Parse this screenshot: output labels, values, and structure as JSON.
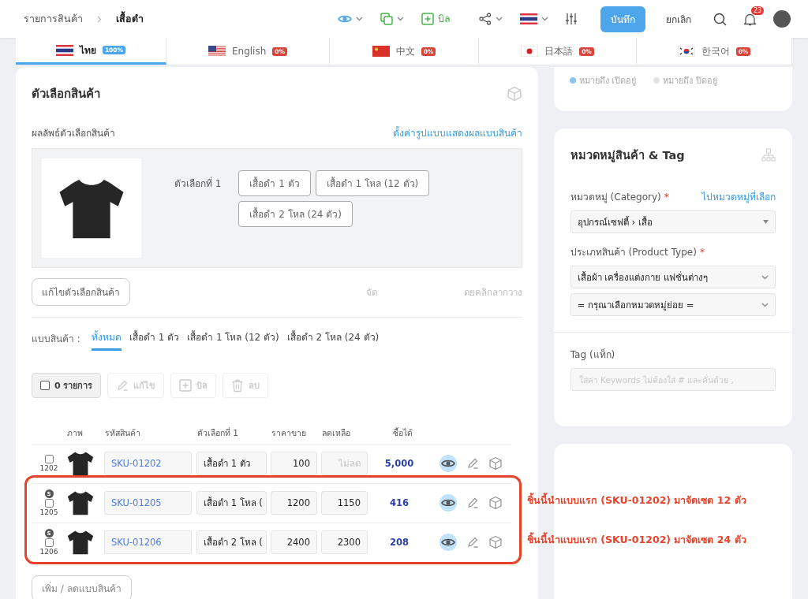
{
  "breadcrumb": {
    "parent": "รายการสินค้า",
    "current": "เสื้อดำ"
  },
  "toolbar": {
    "bill_button": "บิล",
    "save_button": "บันทึก",
    "cancel_button": "ยกเลิก",
    "notification_count": "23"
  },
  "language_tabs": [
    {
      "kind": "th",
      "label": "ไทย",
      "progress": "100%",
      "color": "#4ea6ea",
      "selected": true
    },
    {
      "kind": "us",
      "label": "English",
      "progress": "0%",
      "color": "#d8453b",
      "selected": false
    },
    {
      "kind": "cn",
      "label": "中文",
      "progress": "0%",
      "color": "#d8453b",
      "selected": false
    },
    {
      "kind": "jp",
      "label": "日本語",
      "progress": "0%",
      "color": "#d8453b",
      "selected": false
    },
    {
      "kind": "kr",
      "label": "한국어",
      "progress": "0%",
      "color": "#d8453b",
      "selected": false
    }
  ],
  "variant_card": {
    "title": "ตัวเลือกสินค้า",
    "results_label": "ผลลัพธ์ตัวเลือกสินค้า",
    "display_settings_link": "ตั้งค่ารูปแบบแสดงผลแบบสินค้า",
    "option_label": "ตัวเลือกที่ 1",
    "option_values": [
      "เสื้อดำ 1 ตัว",
      "เสื้อดำ 1 โหล (12 ตัว)",
      "เสื้อดำ 2 โหล (24 ตัว)"
    ],
    "edit_options_button": "แก้ไขตัวเลือกสินค้า",
    "sort_hint_start": "จัด",
    "sort_hint_end": "ดยคลิกลากวาง",
    "filter_label": "แบบสินค้า :",
    "filters": [
      {
        "label": "ทั้งหมด",
        "selected": true
      },
      {
        "label": "เสื้อดำ 1 ตัว",
        "selected": false
      },
      {
        "label": "เสื้อดำ 1 โหล (12 ตัว)",
        "selected": false
      },
      {
        "label": "เสื้อดำ 2 โหล (24 ตัว)",
        "selected": false
      }
    ],
    "bulk_actions": [
      {
        "kind": "select",
        "label": "0 รายการ",
        "checked": false,
        "disabled": false
      },
      {
        "kind": "edit",
        "label": "แก้ไข",
        "disabled": true
      },
      {
        "kind": "bill",
        "label": "บิล",
        "disabled": true
      },
      {
        "kind": "delete",
        "label": "ลบ",
        "disabled": true
      }
    ],
    "columns": [
      "ภาพ",
      "รหัสสินค้า",
      "ตัวเลือกที่ 1",
      "ราคาขาย",
      "ลดเหลือ",
      "ซื้อได้"
    ],
    "rows": [
      {
        "badge": "",
        "checked": false,
        "number": "1202",
        "sku": "SKU-01202",
        "option": "เสื้อดำ 1 ตัว",
        "price": "100",
        "discount_placeholder": "ไม่ลด",
        "buyable": "5,000"
      },
      {
        "badge": "S",
        "checked": false,
        "number": "1205",
        "sku": "SKU-01205",
        "option": "เสื้อดำ 1 โหล (",
        "price": "1200",
        "discount": "1150",
        "buyable": "416"
      },
      {
        "badge": "S",
        "checked": false,
        "number": "1206",
        "sku": "SKU-01206",
        "option": "เสื้อดำ 2 โหล (",
        "price": "2400",
        "discount": "2300",
        "buyable": "208"
      }
    ],
    "add_remove_button": "เพิ่ม / ลดแบบสินค้า"
  },
  "status_legend": [
    {
      "label": "หมายถึง เปิดอยู่",
      "color": "#8ec5f0"
    },
    {
      "label": "หมายถึง ปิดอยู่",
      "color": "#e4e4e4"
    }
  ],
  "category_card": {
    "title": "หมวดหมู่สินค้า & Tag",
    "category_label": "หมวดหมู่ (Category)",
    "category_required": "*",
    "go_to_category_link": "ไปหมวดหมู่ที่เลือก",
    "category_value": "อุปกรณ์เซฟตี้ › เสื้อ",
    "type_label": "ประเภทสินค้า (Product Type)",
    "type_required": "*",
    "type_value": "เสื้อผ้า เครื่องแต่งกาย แฟชั่นต่างๆ",
    "subcategory_value": "= กรุณาเลือกหมวดหมู่ย่อย =",
    "tag_label": "Tag (แท็ก)",
    "tag_placeholder": "ใส่ค่า Keywords ไม่ต้องใส่ # และคั่นด้วย ,"
  },
  "annotation": {
    "notes": [
      "ชิ้นนี้นำแบบแรก (SKU-01202) มาจัดเซต 12 ตัว",
      "ชิ้นนี้นำแบบแรก (SKU-01202) มาจัดเซต 24 ตัว"
    ]
  }
}
